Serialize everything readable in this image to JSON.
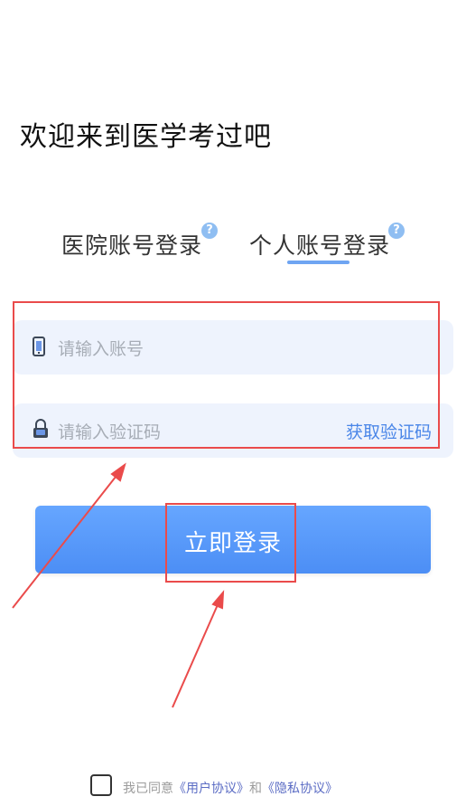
{
  "header": {
    "title": "欢迎来到医学考过吧"
  },
  "tabs": [
    {
      "label": "医院账号登录",
      "help": "?"
    },
    {
      "label": "个人账号登录",
      "help": "?",
      "active": true
    }
  ],
  "form": {
    "account": {
      "placeholder": "请输入账号",
      "icon": "phone-icon"
    },
    "code": {
      "placeholder": "请输入验证码",
      "icon": "lock-icon",
      "action": "获取验证码"
    }
  },
  "login_button": {
    "label": "立即登录"
  },
  "agreement": {
    "prefix": "我已同意",
    "user_agreement": "《用户协议》",
    "conjunction": "和",
    "privacy_agreement": "《隐私协议》"
  },
  "colors": {
    "accent": "#4c8ef5",
    "annotation": "#ea4b4b",
    "field_bg": "#eef3fd",
    "link": "#5b6cc4"
  }
}
